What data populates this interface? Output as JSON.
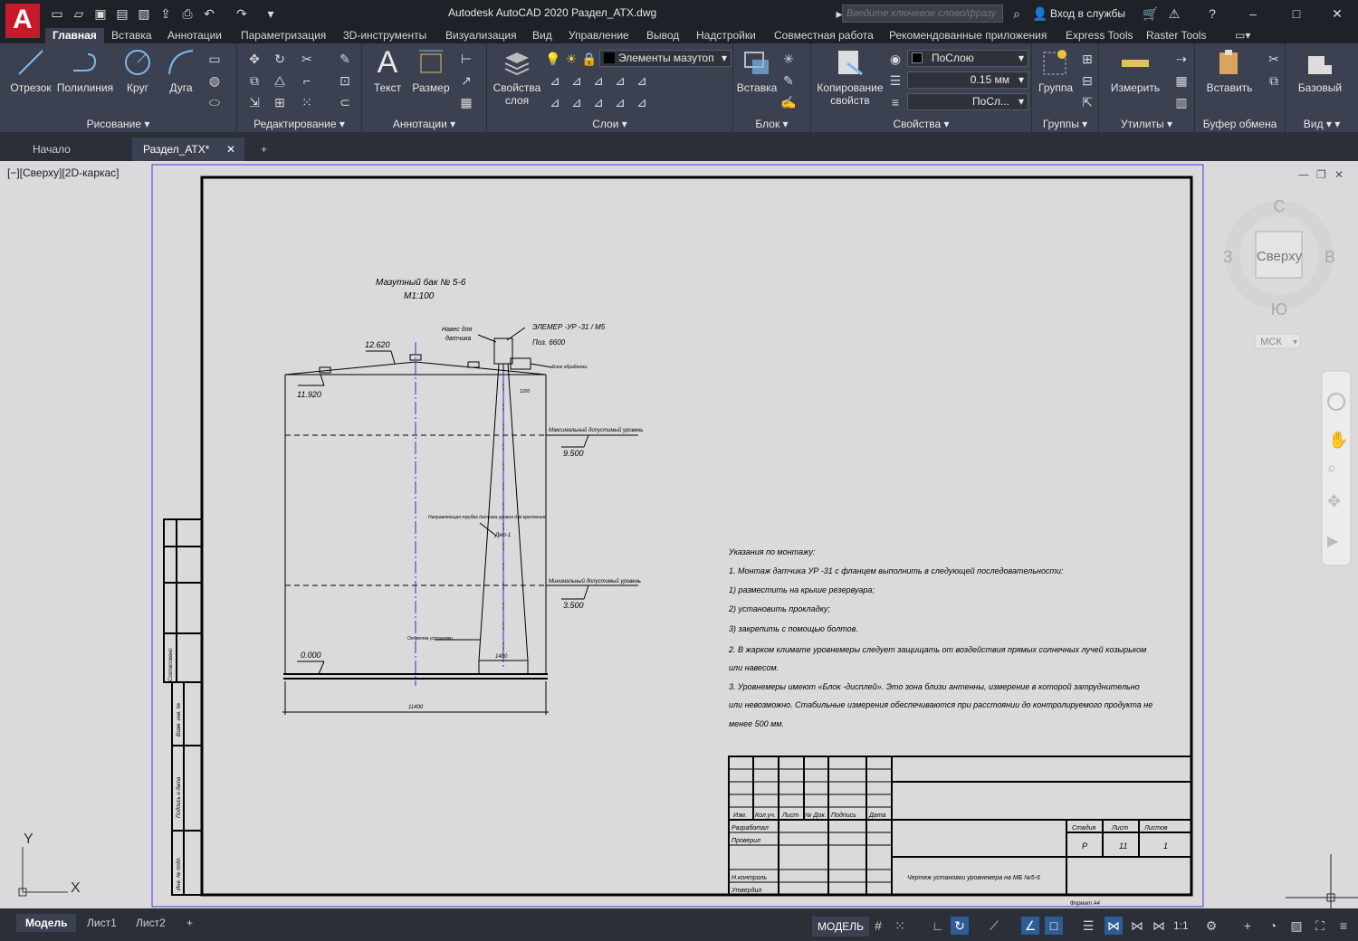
{
  "app": {
    "logo": "A",
    "title": "Autodesk AutoCAD 2020   Раздел_АТХ.dwg",
    "search_placeholder": "Введите ключевое слово/фразу",
    "login": "Вход в службы",
    "help": "?"
  },
  "ribbon_tabs": [
    "Главная",
    "Вставка",
    "Аннотации",
    "Параметризация",
    "3D-инструменты",
    "Визуализация",
    "Вид",
    "Управление",
    "Вывод",
    "Надстройки",
    "Совместная работа",
    "Рекомендованные приложения",
    "Express Tools",
    "Raster Tools"
  ],
  "ribbon": {
    "draw": {
      "title": "Рисование",
      "buttons": [
        "Отрезок",
        "Полилиния",
        "Круг",
        "Дуга"
      ]
    },
    "modify": {
      "title": "Редактирование"
    },
    "annotation": {
      "title": "Аннотации",
      "buttons": [
        "Текст",
        "Размер"
      ]
    },
    "layers": {
      "title": "Слои",
      "button": "Свойства слоя",
      "current_layer": "Элементы мазутоп"
    },
    "block": {
      "title": "Блок",
      "button": "Вставка"
    },
    "properties": {
      "title": "Свойства",
      "button": "Копирование свойств",
      "color": "ПоСлою",
      "lineweight": "0.15 мм",
      "linetype": "ПоСл..."
    },
    "groups": {
      "title": "Группы",
      "button": "Группа"
    },
    "utilities": {
      "title": "Утилиты",
      "button": "Измерить"
    },
    "clipboard": {
      "title": "Буфер обмена",
      "button": "Вставить"
    },
    "view": {
      "title": "Вид",
      "button": "Базовый"
    }
  },
  "doc_tabs": [
    "Начало",
    "Раздел_АТХ*"
  ],
  "viewport": {
    "label": "[−][Сверху][2D-каркас]",
    "viewcube": {
      "n": "С",
      "s": "Ю",
      "w": "З",
      "e": "В",
      "face": "Сверху",
      "ucs": "МСК"
    }
  },
  "drawing": {
    "tank_title": "Мазутный бак № 5-6",
    "scale": "М1:100",
    "elev_top": "12.620",
    "elev_wall": "11.920",
    "elev_bottom": "0.000",
    "nav_label1": "Навес для",
    "nav_label2": "датчика",
    "sensor_code": "ЭЛЕМЕР -УР -31 / М5",
    "pos_label": "Поз. 6600",
    "box_label": "Блок обработки",
    "max_level_label": "Максимальный допустимый уровень",
    "max_level": "9.500",
    "min_level_label": "Минимальный допустимый уровень",
    "min_level": "3.500",
    "dim_note": "Дмл-1",
    "width": "11400",
    "hole_label": "Отметка установки",
    "guide_label": "Направляющая трубка датчика уровня для крепления",
    "bottom_mark": "1400",
    "top_mark": "1200",
    "notes_title": "Указания по монтажу:",
    "notes": [
      "1. Монтаж датчика УР -31 с фланцем выполнить в следующей последовательности:",
      "1)        разместить на крыше резервуара;",
      "2)        установить прокладку;",
      "3)        закрепить с помощью болтов.",
      "2. В жарком климате уровнемеры следует защищать от воздействия прямых солнечных лучей козырьком",
      "или навесом.",
      "3. Уровнемеры имеют «Блок -дисплей». Это зона близи антенны, измерение в которой затруднительно",
      "или невозможно. Стабильные измерения обеспечиваются при расстоянии до контролируемого продукта не",
      "менее 500 мм."
    ],
    "stamp_header": [
      "Изм.",
      "Кол.уч.",
      "Лист",
      "№ Док.",
      "Подпись",
      "Дата"
    ],
    "stamp_roles": [
      "Разработал",
      "Проверил",
      "Н.контроль",
      "Утвердил"
    ],
    "stamp_sheet_headers": [
      "Стадия",
      "Лист",
      "Листов"
    ],
    "stamp_sheet_values": [
      "Р",
      "11",
      "1"
    ],
    "stamp_name": "Чертеж установки уровнемера на МБ №5-6",
    "format": "Формат А4",
    "side_labels": [
      "Согласовано",
      "Взам. инв. №",
      "Подпись и дата",
      "Инв. № подл."
    ]
  },
  "axes": {
    "y": "Y",
    "x": "X"
  },
  "status": {
    "tabs": [
      "Модель",
      "Лист1",
      "Лист2"
    ],
    "model_button": "МОДЕЛЬ",
    "scale": "1:1"
  }
}
